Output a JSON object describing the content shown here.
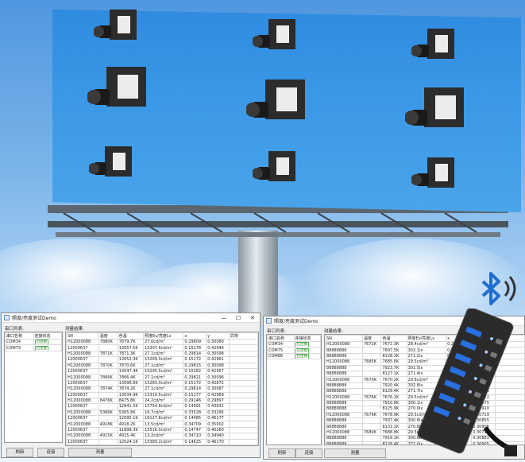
{
  "left_window": {
    "title": "照度/亮度测试Demo",
    "controls": [
      "—",
      "☐",
      "✕"
    ],
    "serial_label": "串口列表:",
    "results_label": "测量结果:",
    "ports_header": [
      "串口名称",
      "连接状态"
    ],
    "ports": [
      [
        "COM34",
        "已连接"
      ],
      [
        "COM73",
        "已连接"
      ]
    ],
    "results_header": [
      "SN",
      "温度",
      "色温",
      "照度Ev/亮度Lv",
      "x",
      "y",
      "异常"
    ],
    "results": [
      [
        "H12000088",
        "7880K",
        "7879.7K",
        "27.0cd/m²",
        "0.29809",
        "0.30080",
        ""
      ],
      [
        "12000637",
        "",
        "13057.5K",
        "15307.6cd/m²",
        "0.15178",
        "0.42946",
        ""
      ],
      [
        "H12000088",
        "7871K",
        "7871.3K",
        "27.1cd/m²",
        "0.29814",
        "0.30098",
        ""
      ],
      [
        "12000637",
        "",
        "13052.3K",
        "15289.0cd/m²",
        "0.15172",
        "0.42961",
        ""
      ],
      [
        "H12000088",
        "7870K",
        "7870.6K",
        "27.1cd/m²",
        "0.29815",
        "0.30098",
        ""
      ],
      [
        "12000637",
        "",
        "13047.4K",
        "15295.5cd/m²",
        "0.15182",
        "0.42957",
        ""
      ],
      [
        "H12000088",
        "7866K",
        "7866.4K",
        "27.1cd/m²",
        "0.29821",
        "0.30096",
        ""
      ],
      [
        "12000637",
        "",
        "13098.6K",
        "15283.0cd/m²",
        "0.15172",
        "0.42872",
        ""
      ],
      [
        "H12000088",
        "7874K",
        "7874.2K",
        "27.1cd/m²",
        "0.29814",
        "0.30087",
        ""
      ],
      [
        "12000637",
        "",
        "13034.9K",
        "15310.5cd/m²",
        "0.15177",
        "0.42969",
        ""
      ],
      [
        "H12000088",
        "8476K",
        "8475.8K",
        "24.2cd/m²",
        "0.29146",
        "0.29897",
        ""
      ],
      [
        "12000637",
        "",
        "12841.5K",
        "15754.8cd/m²",
        "0.14991",
        "0.43632",
        ""
      ],
      [
        "H12000088",
        "5366K",
        "5365.8K",
        "16.7cd/m²",
        "0.33528",
        "0.33295",
        ""
      ],
      [
        "12000637",
        "",
        "12095.1K",
        "16127.6cd/m²",
        "0.14485",
        "0.46177",
        ""
      ],
      [
        "H12000088",
        "4918K",
        "4918.2K",
        "13.5cd/m²",
        "0.34709",
        "0.35002",
        ""
      ],
      [
        "12000637",
        "",
        "11898.3K",
        "15516.0cd/m²",
        "0.14747",
        "0.46260",
        ""
      ],
      [
        "H12000088",
        "4915K",
        "4915.4K",
        "13.2cd/m²",
        "0.34710",
        "0.34940",
        ""
      ],
      [
        "12000637",
        "",
        "12024.1K",
        "15389.2cd/m²",
        "0.14625",
        "0.46170",
        ""
      ]
    ],
    "buttons": {
      "refresh": "刷新",
      "connect": "连接",
      "measure": "测量"
    }
  },
  "right_window": {
    "title": "照度/亮度测试Demo",
    "serial_label": "串口列表:",
    "results_label": "测量结果:",
    "ports_header": [
      "串口名称",
      "连接状态"
    ],
    "ports": [
      [
        "COM34",
        "已连接"
      ],
      [
        "COM75",
        "已连接"
      ],
      [
        "COM88",
        "已连接"
      ]
    ],
    "results_header": [
      "SN",
      "温度",
      "色温",
      "照度Ev/亮度Lv",
      "x",
      "y",
      "异常"
    ],
    "results": [
      [
        "H12000088",
        "7672K",
        "7672.3K",
        "28.4cd/m²",
        "0.29880",
        "0.30733",
        ""
      ],
      [
        "88888888",
        "",
        "7897.5K",
        "302.1lx",
        "0.29522",
        "0.30889",
        ""
      ],
      [
        "88888888",
        "",
        "8128.3K",
        "271.2lx",
        "0.29206",
        "0.30904",
        ""
      ],
      [
        "H12000088",
        "7685K",
        "7685.6K",
        "29.5cd/m²",
        "0.29866",
        "0.30715",
        ""
      ],
      [
        "88888888",
        "",
        "7923.7K",
        "301.5lx",
        "0.29495",
        "0.30863",
        ""
      ],
      [
        "88888888",
        "",
        "8127.1K",
        "271.4lx",
        "0.29206",
        "0.30908",
        ""
      ],
      [
        "H12000088",
        "7670K",
        "7670.2K",
        "29.6cd/m²",
        "0.29884",
        "0.30727",
        ""
      ],
      [
        "88888888",
        "",
        "7920.4K",
        "302.8lx",
        "0.29498",
        "0.30860",
        ""
      ],
      [
        "88888888",
        "",
        "8129.4K",
        "271.7lx",
        "0.29204",
        "0.30903",
        ""
      ],
      [
        "H12000088",
        "7676K",
        "7676.1K",
        "29.5cd/m²",
        "0.29879",
        "0.30722",
        ""
      ],
      [
        "88888888",
        "",
        "7910.8K",
        "300.1lx",
        "0.29502",
        "0.30875",
        ""
      ],
      [
        "88888888",
        "",
        "8125.9K",
        "270.0lx",
        "0.29209",
        "0.30910",
        ""
      ],
      [
        "H12000088",
        "7679K",
        "7678.9K",
        "29.5cd/m²",
        "0.29874",
        "0.30719",
        ""
      ],
      [
        "88888888",
        "",
        "7937.4K",
        "300.6lx",
        "0.29483",
        "0.30855",
        ""
      ],
      [
        "88888888",
        "",
        "8131.1K",
        "270.8lx",
        "0.29202",
        "0.30906",
        ""
      ],
      [
        "H12000088",
        "7689K",
        "7688.8K",
        "29.5cd/m²",
        "0.29863",
        "0.30711",
        ""
      ],
      [
        "88888888",
        "",
        "7919.1K",
        "300.8lx",
        "0.29495",
        "0.30881",
        ""
      ],
      [
        "88888888",
        "",
        "8128.4K",
        "271.0lx",
        "0.29205",
        "0.30905",
        ""
      ]
    ],
    "buttons": {
      "refresh": "刷新",
      "connect": "连接",
      "measure": "测量"
    }
  }
}
